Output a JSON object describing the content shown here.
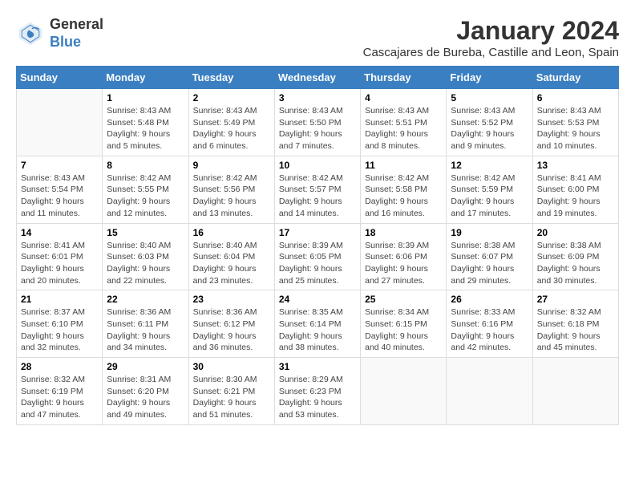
{
  "header": {
    "logo_general": "General",
    "logo_blue": "Blue",
    "month_title": "January 2024",
    "subtitle": "Cascajares de Bureba, Castille and Leon, Spain"
  },
  "days_of_week": [
    "Sunday",
    "Monday",
    "Tuesday",
    "Wednesday",
    "Thursday",
    "Friday",
    "Saturday"
  ],
  "weeks": [
    [
      {
        "day": "",
        "info": ""
      },
      {
        "day": "1",
        "info": "Sunrise: 8:43 AM\nSunset: 5:48 PM\nDaylight: 9 hours\nand 5 minutes."
      },
      {
        "day": "2",
        "info": "Sunrise: 8:43 AM\nSunset: 5:49 PM\nDaylight: 9 hours\nand 6 minutes."
      },
      {
        "day": "3",
        "info": "Sunrise: 8:43 AM\nSunset: 5:50 PM\nDaylight: 9 hours\nand 7 minutes."
      },
      {
        "day": "4",
        "info": "Sunrise: 8:43 AM\nSunset: 5:51 PM\nDaylight: 9 hours\nand 8 minutes."
      },
      {
        "day": "5",
        "info": "Sunrise: 8:43 AM\nSunset: 5:52 PM\nDaylight: 9 hours\nand 9 minutes."
      },
      {
        "day": "6",
        "info": "Sunrise: 8:43 AM\nSunset: 5:53 PM\nDaylight: 9 hours\nand 10 minutes."
      }
    ],
    [
      {
        "day": "7",
        "info": "Sunrise: 8:43 AM\nSunset: 5:54 PM\nDaylight: 9 hours\nand 11 minutes."
      },
      {
        "day": "8",
        "info": "Sunrise: 8:42 AM\nSunset: 5:55 PM\nDaylight: 9 hours\nand 12 minutes."
      },
      {
        "day": "9",
        "info": "Sunrise: 8:42 AM\nSunset: 5:56 PM\nDaylight: 9 hours\nand 13 minutes."
      },
      {
        "day": "10",
        "info": "Sunrise: 8:42 AM\nSunset: 5:57 PM\nDaylight: 9 hours\nand 14 minutes."
      },
      {
        "day": "11",
        "info": "Sunrise: 8:42 AM\nSunset: 5:58 PM\nDaylight: 9 hours\nand 16 minutes."
      },
      {
        "day": "12",
        "info": "Sunrise: 8:42 AM\nSunset: 5:59 PM\nDaylight: 9 hours\nand 17 minutes."
      },
      {
        "day": "13",
        "info": "Sunrise: 8:41 AM\nSunset: 6:00 PM\nDaylight: 9 hours\nand 19 minutes."
      }
    ],
    [
      {
        "day": "14",
        "info": "Sunrise: 8:41 AM\nSunset: 6:01 PM\nDaylight: 9 hours\nand 20 minutes."
      },
      {
        "day": "15",
        "info": "Sunrise: 8:40 AM\nSunset: 6:03 PM\nDaylight: 9 hours\nand 22 minutes."
      },
      {
        "day": "16",
        "info": "Sunrise: 8:40 AM\nSunset: 6:04 PM\nDaylight: 9 hours\nand 23 minutes."
      },
      {
        "day": "17",
        "info": "Sunrise: 8:39 AM\nSunset: 6:05 PM\nDaylight: 9 hours\nand 25 minutes."
      },
      {
        "day": "18",
        "info": "Sunrise: 8:39 AM\nSunset: 6:06 PM\nDaylight: 9 hours\nand 27 minutes."
      },
      {
        "day": "19",
        "info": "Sunrise: 8:38 AM\nSunset: 6:07 PM\nDaylight: 9 hours\nand 29 minutes."
      },
      {
        "day": "20",
        "info": "Sunrise: 8:38 AM\nSunset: 6:09 PM\nDaylight: 9 hours\nand 30 minutes."
      }
    ],
    [
      {
        "day": "21",
        "info": "Sunrise: 8:37 AM\nSunset: 6:10 PM\nDaylight: 9 hours\nand 32 minutes."
      },
      {
        "day": "22",
        "info": "Sunrise: 8:36 AM\nSunset: 6:11 PM\nDaylight: 9 hours\nand 34 minutes."
      },
      {
        "day": "23",
        "info": "Sunrise: 8:36 AM\nSunset: 6:12 PM\nDaylight: 9 hours\nand 36 minutes."
      },
      {
        "day": "24",
        "info": "Sunrise: 8:35 AM\nSunset: 6:14 PM\nDaylight: 9 hours\nand 38 minutes."
      },
      {
        "day": "25",
        "info": "Sunrise: 8:34 AM\nSunset: 6:15 PM\nDaylight: 9 hours\nand 40 minutes."
      },
      {
        "day": "26",
        "info": "Sunrise: 8:33 AM\nSunset: 6:16 PM\nDaylight: 9 hours\nand 42 minutes."
      },
      {
        "day": "27",
        "info": "Sunrise: 8:32 AM\nSunset: 6:18 PM\nDaylight: 9 hours\nand 45 minutes."
      }
    ],
    [
      {
        "day": "28",
        "info": "Sunrise: 8:32 AM\nSunset: 6:19 PM\nDaylight: 9 hours\nand 47 minutes."
      },
      {
        "day": "29",
        "info": "Sunrise: 8:31 AM\nSunset: 6:20 PM\nDaylight: 9 hours\nand 49 minutes."
      },
      {
        "day": "30",
        "info": "Sunrise: 8:30 AM\nSunset: 6:21 PM\nDaylight: 9 hours\nand 51 minutes."
      },
      {
        "day": "31",
        "info": "Sunrise: 8:29 AM\nSunset: 6:23 PM\nDaylight: 9 hours\nand 53 minutes."
      },
      {
        "day": "",
        "info": ""
      },
      {
        "day": "",
        "info": ""
      },
      {
        "day": "",
        "info": ""
      }
    ]
  ]
}
